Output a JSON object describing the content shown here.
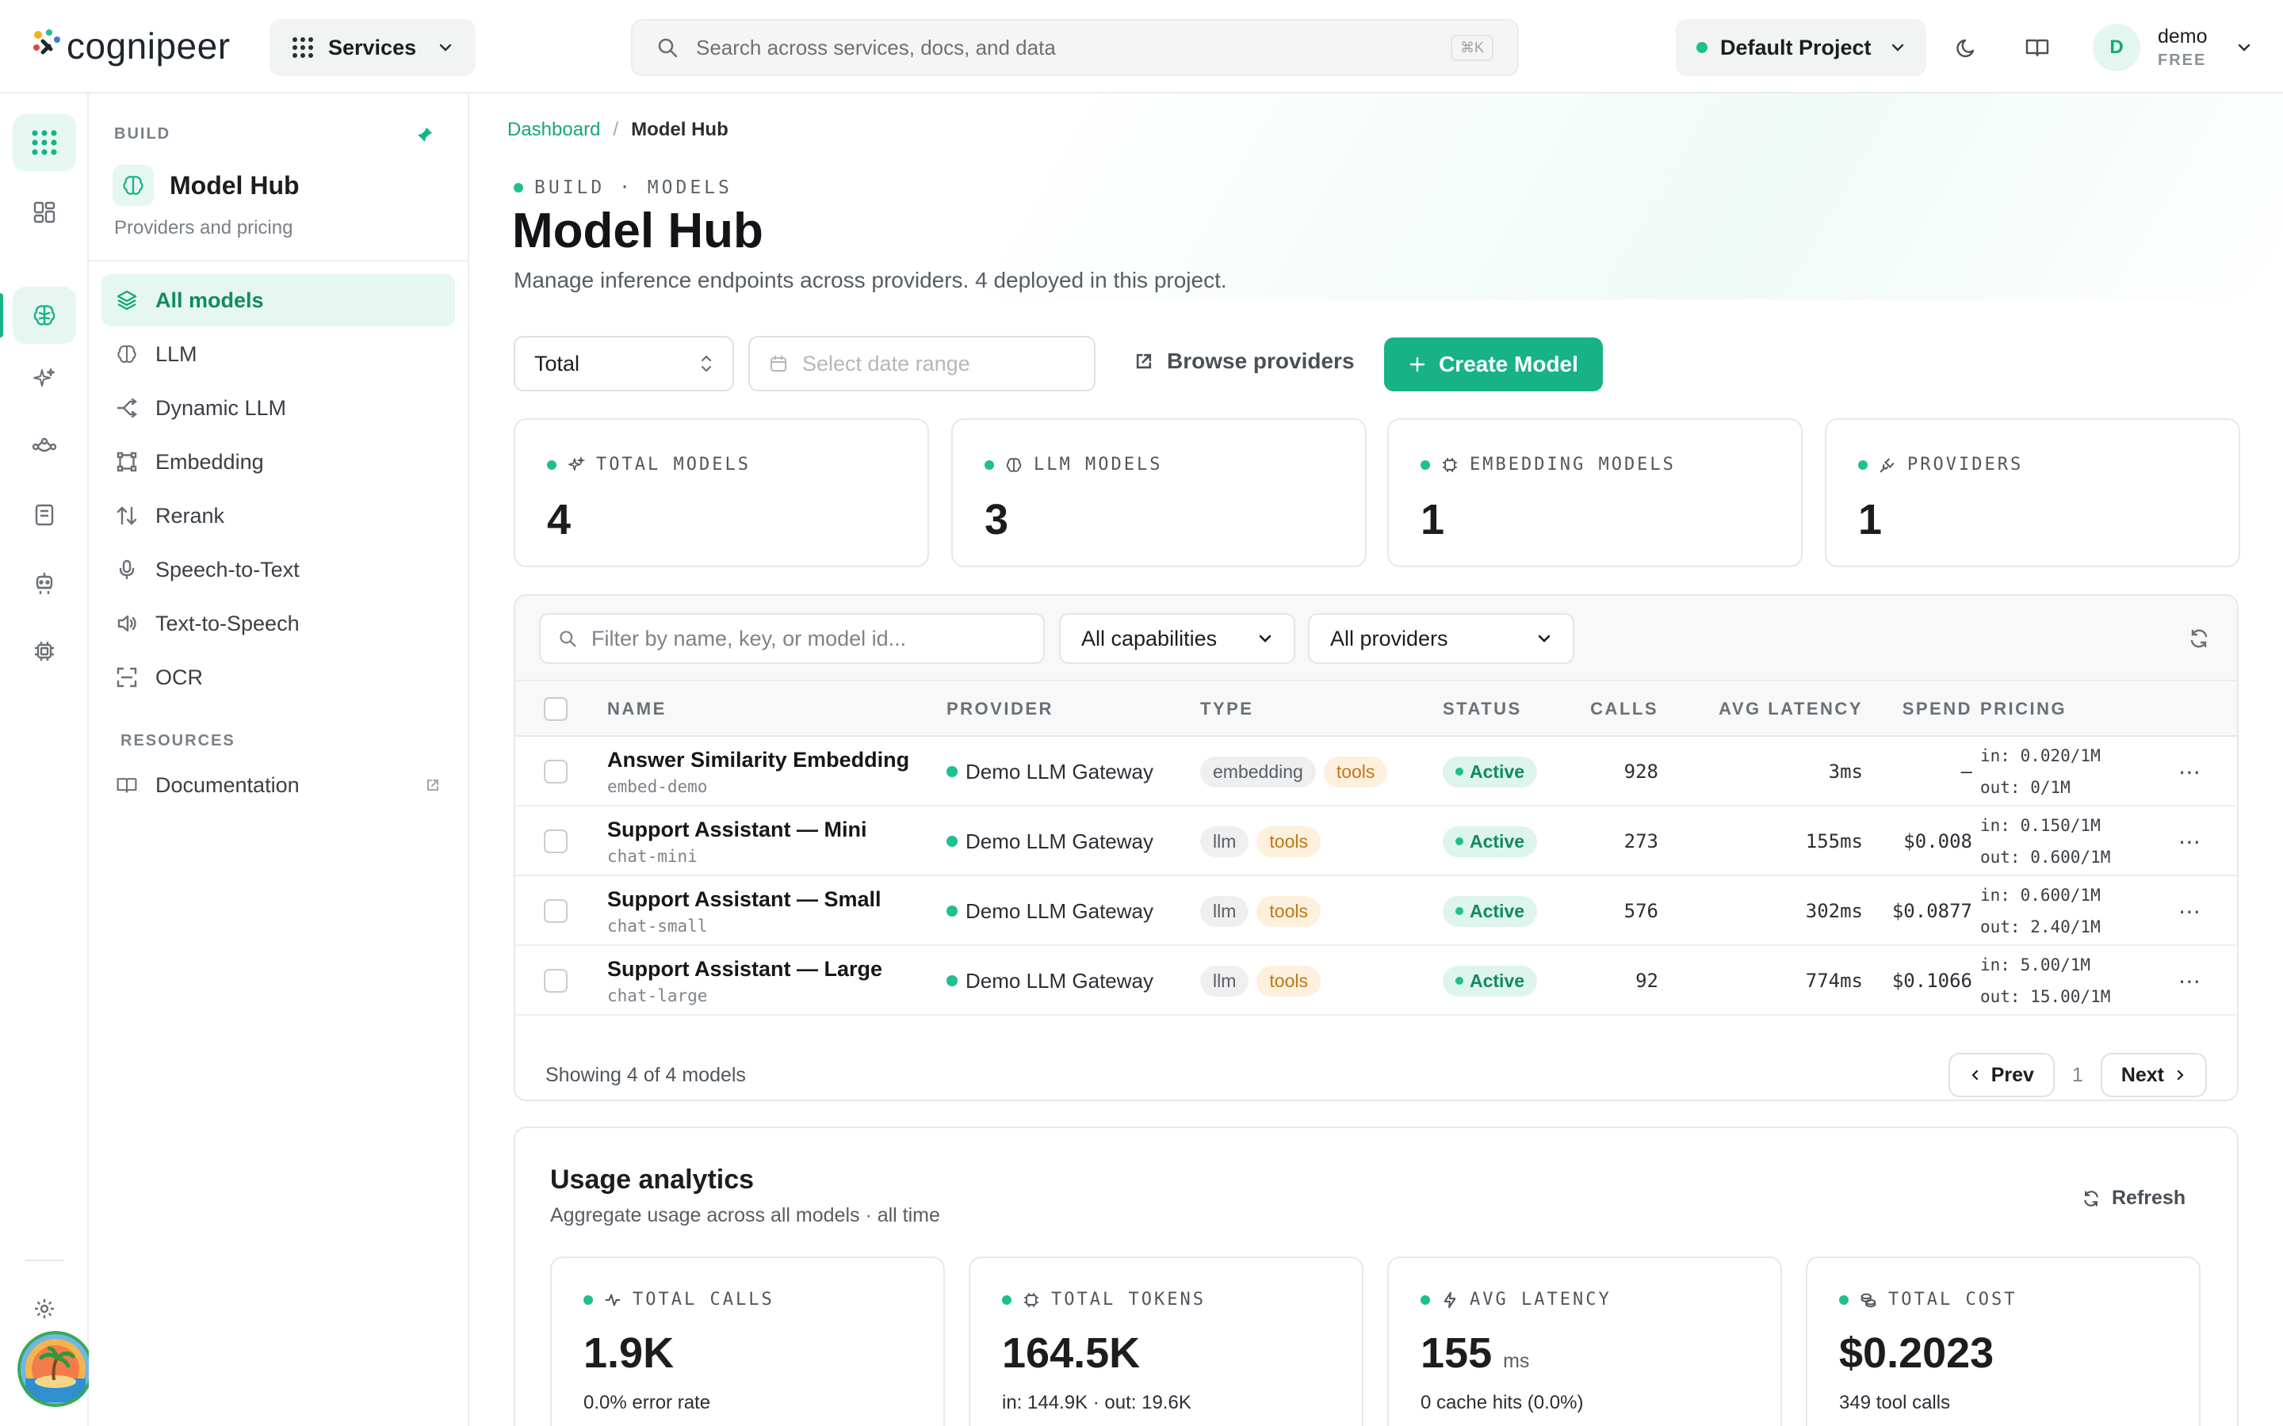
{
  "brand": {
    "name": "cognipeer"
  },
  "topbar": {
    "services_label": "Services",
    "search_placeholder": "Search across services, docs, and data",
    "search_shortcut": "⌘K",
    "project_label": "Default Project",
    "user_initial": "D",
    "user_name": "demo",
    "user_plan": "FREE"
  },
  "sidebar": {
    "section": "BUILD",
    "title": "Model Hub",
    "subtitle": "Providers and pricing",
    "items": [
      {
        "label": "All models",
        "icon": "layers-icon",
        "active": true
      },
      {
        "label": "LLM",
        "icon": "brain-icon"
      },
      {
        "label": "Dynamic LLM",
        "icon": "split-icon"
      },
      {
        "label": "Embedding",
        "icon": "vector-icon"
      },
      {
        "label": "Rerank",
        "icon": "sort-icon"
      },
      {
        "label": "Speech-to-Text",
        "icon": "mic-icon"
      },
      {
        "label": "Text-to-Speech",
        "icon": "speaker-icon"
      },
      {
        "label": "OCR",
        "icon": "scan-icon"
      }
    ],
    "resources_label": "RESOURCES",
    "resources": [
      {
        "label": "Documentation",
        "icon": "book-icon"
      }
    ]
  },
  "breadcrumb": {
    "parent": "Dashboard",
    "sep": "/",
    "current": "Model Hub"
  },
  "header": {
    "eyebrow": "BUILD · MODELS",
    "title": "Model Hub",
    "description": "Manage inference endpoints across providers. 4 deployed in this project."
  },
  "toolbar": {
    "range_value": "Total",
    "date_placeholder": "Select date range",
    "browse_label": "Browse providers",
    "create_label": "Create Model"
  },
  "stats": [
    {
      "label": "TOTAL MODELS",
      "value": "4",
      "icon": "sparkle-icon"
    },
    {
      "label": "LLM MODELS",
      "value": "3",
      "icon": "brain-icon"
    },
    {
      "label": "EMBEDDING MODELS",
      "value": "1",
      "icon": "chip-icon"
    },
    {
      "label": "PROVIDERS",
      "value": "1",
      "icon": "plug-icon"
    }
  ],
  "filters": {
    "search_placeholder": "Filter by name, key, or model id...",
    "capabilities": "All capabilities",
    "providers": "All providers"
  },
  "table": {
    "columns": [
      "NAME",
      "PROVIDER",
      "TYPE",
      "STATUS",
      "CALLS",
      "AVG LATENCY",
      "SPEND",
      "PRICING"
    ],
    "rows": [
      {
        "name": "Answer Similarity Embedding",
        "key": "embed-demo",
        "provider": "Demo LLM Gateway",
        "type": "embedding",
        "cap": "tools",
        "status": "Active",
        "calls": "928",
        "latency": "3ms",
        "spend": "–",
        "price_in": "in: 0.020/1M",
        "price_out": "out: 0/1M"
      },
      {
        "name": "Support Assistant — Mini",
        "key": "chat-mini",
        "provider": "Demo LLM Gateway",
        "type": "llm",
        "cap": "tools",
        "status": "Active",
        "calls": "273",
        "latency": "155ms",
        "spend": "$0.008",
        "price_in": "in: 0.150/1M",
        "price_out": "out: 0.600/1M"
      },
      {
        "name": "Support Assistant — Small",
        "key": "chat-small",
        "provider": "Demo LLM Gateway",
        "type": "llm",
        "cap": "tools",
        "status": "Active",
        "calls": "576",
        "latency": "302ms",
        "spend": "$0.0877",
        "price_in": "in: 0.600/1M",
        "price_out": "out: 2.40/1M"
      },
      {
        "name": "Support Assistant — Large",
        "key": "chat-large",
        "provider": "Demo LLM Gateway",
        "type": "llm",
        "cap": "tools",
        "status": "Active",
        "calls": "92",
        "latency": "774ms",
        "spend": "$0.1066",
        "price_in": "in: 5.00/1M",
        "price_out": "out: 15.00/1M"
      }
    ],
    "footer": "Showing 4 of 4 models",
    "prev": "Prev",
    "page": "1",
    "next": "Next"
  },
  "usage": {
    "title": "Usage analytics",
    "subtitle": "Aggregate usage across all models · all time",
    "refresh": "Refresh",
    "cards": [
      {
        "label": "TOTAL CALLS",
        "value": "1.9K",
        "unit": "",
        "sub": "0.0% error rate",
        "icon": "pulse-icon"
      },
      {
        "label": "TOTAL TOKENS",
        "value": "164.5K",
        "unit": "",
        "sub": "in: 144.9K · out: 19.6K",
        "icon": "chip-icon"
      },
      {
        "label": "AVG LATENCY",
        "value": "155",
        "unit": "ms",
        "sub": "0 cache hits (0.0%)",
        "icon": "bolt-icon"
      },
      {
        "label": "TOTAL COST",
        "value": "$0.2023",
        "unit": "",
        "sub": "349 tool calls",
        "icon": "coins-icon"
      }
    ]
  },
  "colors": {
    "accent": "#17b386",
    "accent_soft": "#e6f7f1",
    "tools_tag": "#c0761a"
  }
}
